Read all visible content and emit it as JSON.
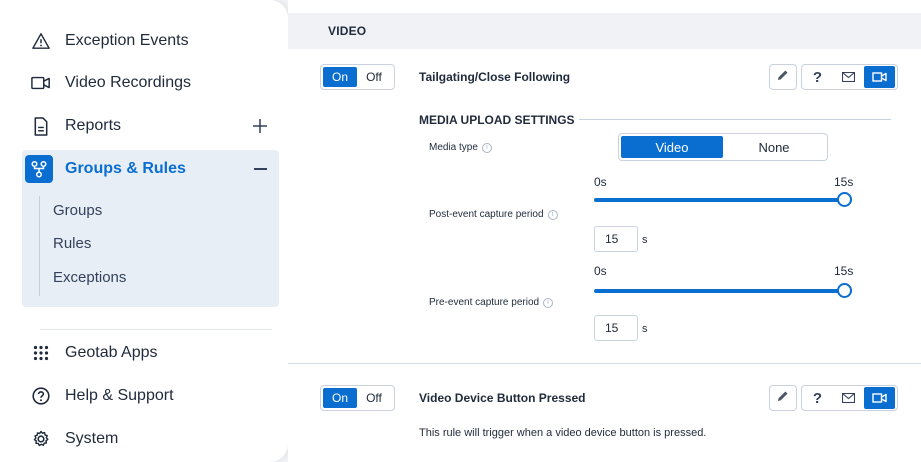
{
  "sidebar": {
    "items": [
      {
        "label": "Exception Events",
        "icon": "warning-triangle-icon"
      },
      {
        "label": "Video Recordings",
        "icon": "video-camera-icon"
      },
      {
        "label": "Reports",
        "icon": "document-icon",
        "action": "+"
      },
      {
        "label": "Groups & Rules",
        "icon": "groups-rules-icon",
        "action": "−"
      },
      {
        "label": "Geotab Apps",
        "icon": "apps-grid-icon"
      },
      {
        "label": "Help & Support",
        "icon": "help-circle-icon"
      },
      {
        "label": "System",
        "icon": "gear-icon"
      }
    ],
    "sub_items": [
      "Groups",
      "Rules",
      "Exceptions"
    ]
  },
  "main": {
    "section_title": "VIDEO",
    "rules": [
      {
        "toggle_on": "On",
        "toggle_off": "Off",
        "name": "Tailgating/Close Following"
      },
      {
        "toggle_on": "On",
        "toggle_off": "Off",
        "name": "Video Device Button Pressed",
        "description": "This rule will trigger when a video device button is pressed."
      }
    ],
    "media": {
      "title": "MEDIA UPLOAD SETTINGS",
      "media_type_label": "Media type",
      "media_type_options": [
        "Video",
        "None"
      ],
      "media_type_selected": "Video",
      "post_label": "Post-event capture period",
      "post_min": "0s",
      "post_max": "15s",
      "post_value": "15",
      "post_unit": "s",
      "pre_label": "Pre-event capture period",
      "pre_min": "0s",
      "pre_max": "15s",
      "pre_value": "15",
      "pre_unit": "s"
    }
  },
  "colors": {
    "accent": "#0a6ed1",
    "sidebar_dark": "#25314f"
  }
}
